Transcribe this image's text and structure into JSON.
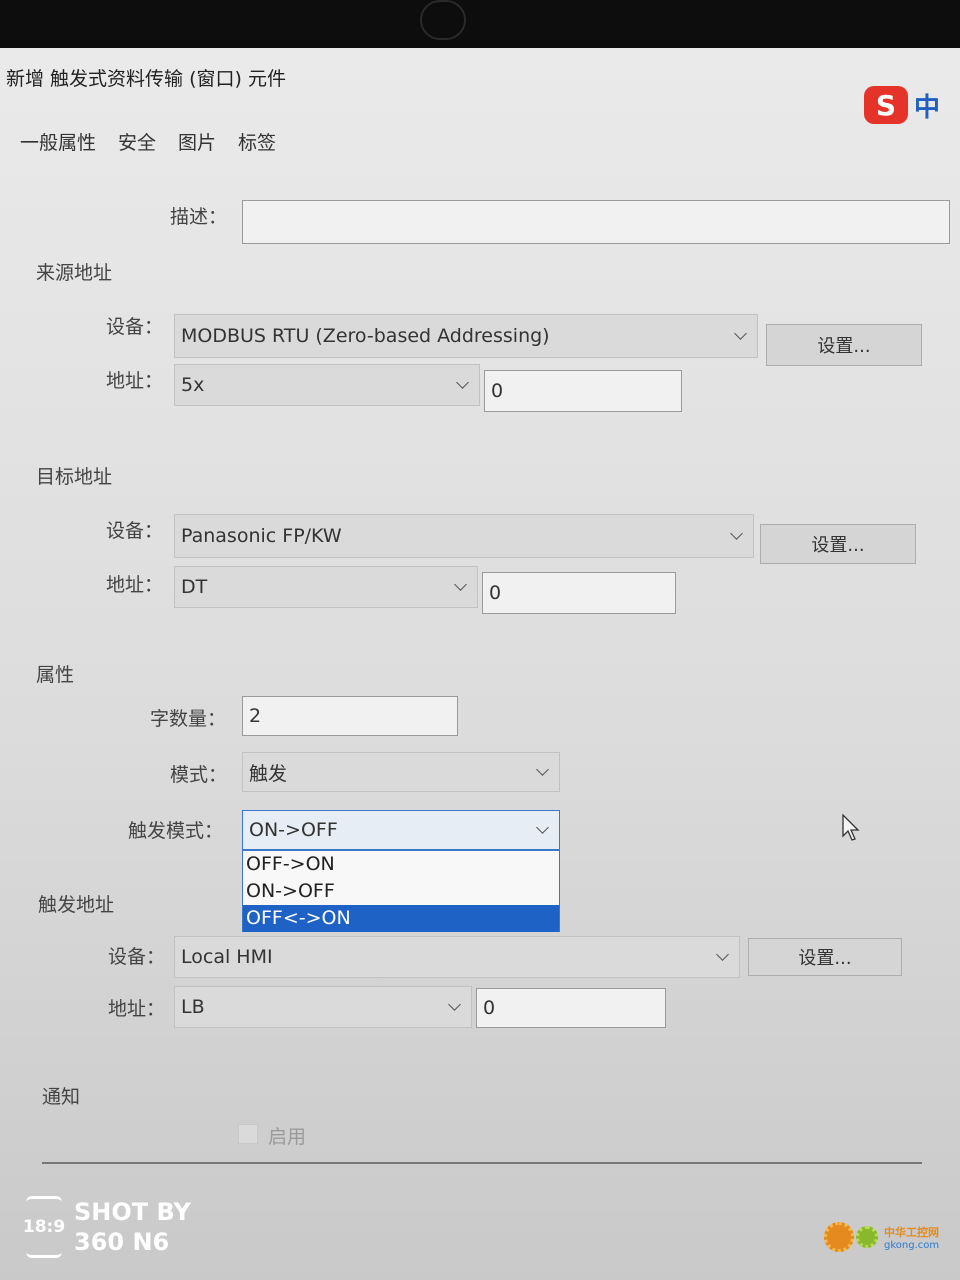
{
  "window": {
    "title": "新增 触发式资料传输 (窗口) 元件"
  },
  "ime": {
    "logo": "S",
    "mode": "中"
  },
  "tabs": [
    "一般属性",
    "安全",
    "图片",
    "标签"
  ],
  "description": {
    "label": "描述：",
    "value": ""
  },
  "source": {
    "heading": "来源地址",
    "device_label": "设备：",
    "device": "MODBUS RTU (Zero-based Addressing)",
    "settings_button": "设置...",
    "address_label": "地址：",
    "address_type": "5x",
    "address_value": "0"
  },
  "target": {
    "heading": "目标地址",
    "device_label": "设备：",
    "device": "Panasonic FP/KW",
    "settings_button": "设置...",
    "address_label": "地址：",
    "address_type": "DT",
    "address_value": "0"
  },
  "properties": {
    "heading": "属性",
    "word_count_label": "字数量：",
    "word_count": "2",
    "mode_label": "模式：",
    "mode": "触发",
    "trigger_mode_label": "触发模式：",
    "trigger_mode": "ON->OFF",
    "trigger_mode_options": [
      "OFF->ON",
      "ON->OFF",
      "OFF<->ON"
    ],
    "highlighted_option": "OFF<->ON"
  },
  "trigger": {
    "heading": "触发地址",
    "device_label": "设备：",
    "device": "Local HMI",
    "settings_button": "设置...",
    "address_label": "地址：",
    "address_type": "LB",
    "address_value": "0"
  },
  "notify": {
    "heading": "通知",
    "enable_label": "启用",
    "enabled": false
  },
  "watermark": {
    "time": "18:9",
    "line1": "SHOT BY",
    "line2": "360 N6",
    "site_name": "中华工控网",
    "site_url": "gkong.com"
  },
  "colors": {
    "selection": "#1f62c6",
    "ime_red": "#e5332a",
    "ime_blue": "#1f5fbf"
  }
}
